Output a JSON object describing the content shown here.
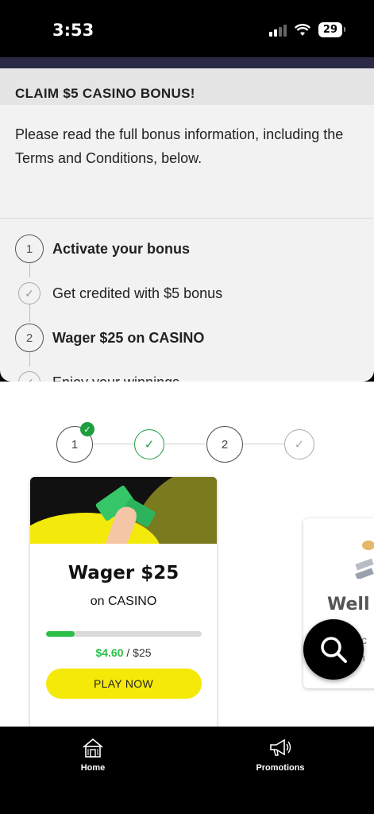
{
  "status_bar": {
    "time": "3:53",
    "battery": "29"
  },
  "bonus": {
    "title": "CLAIM $5 CASINO BONUS!",
    "description": "Please read the full bonus information, including the Terms and Conditions, below.",
    "steps": [
      {
        "marker": "1",
        "label": "Activate your bonus",
        "bold": true
      },
      {
        "marker": "check",
        "label": "Get credited with $5 bonus",
        "bold": false
      },
      {
        "marker": "2",
        "label": "Wager $25 on CASINO",
        "bold": true
      },
      {
        "marker": "check",
        "label": "Enjoy your winnings",
        "bold": false
      }
    ]
  },
  "progress": {
    "step1": "1",
    "step2": "2"
  },
  "card": {
    "title": "Wager $25",
    "subtitle": "on CASINO",
    "current_amount": "$4.60",
    "target_amount": "/ $25",
    "progress_fraction": 0.184,
    "button_label": "PLAY NOW"
  },
  "next_card": {
    "title": "Well",
    "text_line1": "ic",
    "text_line2": "n"
  },
  "tabs": [
    {
      "label": "Home",
      "icon": "home-icon"
    },
    {
      "label": "Promotions",
      "icon": "megaphone-icon"
    }
  ],
  "colors": {
    "accent_green": "#2bbf4a",
    "button_yellow": "#f5e90a"
  }
}
